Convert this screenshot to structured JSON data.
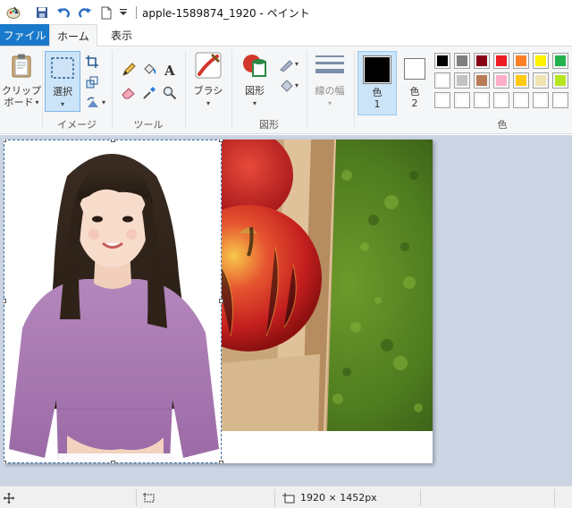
{
  "window": {
    "title": "apple-1589874_1920 - ペイント"
  },
  "tabs": [
    {
      "label": "ファイル"
    },
    {
      "label": "ホーム"
    },
    {
      "label": "表示"
    }
  ],
  "ribbon": {
    "clipboard": {
      "label_line1": "クリップ",
      "label_line2": "ボード"
    },
    "select": {
      "label": "選択"
    },
    "image_group_label": "イメージ",
    "tools_group_label": "ツール",
    "brushes": {
      "label": "ブラシ"
    },
    "shapes": {
      "label": "図形"
    },
    "shapes_group_label": "図形",
    "line_width": {
      "label": "線の幅"
    },
    "color1": {
      "label_line1": "色",
      "label_line2": "1",
      "value": "#000000"
    },
    "color2": {
      "label_line1": "色",
      "label_line2": "2",
      "value": "#ffffff"
    },
    "colors_group_label": "色",
    "palette": [
      "#000000",
      "#7f7f7f",
      "#880015",
      "#ed1c24",
      "#ff7f27",
      "#fff200",
      "#22b14c",
      "#ffffff",
      "#c3c3c3",
      "#b97a57",
      "#ffaec9",
      "#ffc90e",
      "#efe4b0",
      "#b5e61d",
      "#ffffff",
      "#ffffff",
      "#ffffff",
      "#ffffff",
      "#ffffff",
      "#ffffff",
      "#ffffff"
    ]
  },
  "status": {
    "image_size": "1920 × 1452px"
  },
  "colors": {
    "accent": "#1979ca",
    "workspace": "#cbd5e4"
  }
}
